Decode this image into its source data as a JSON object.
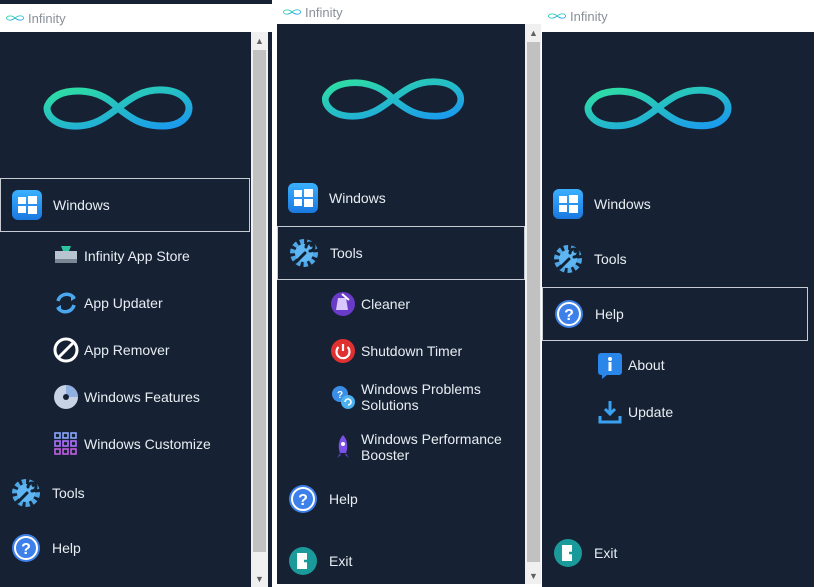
{
  "app": {
    "title": "Infinity"
  },
  "colors": {
    "bg": "#162233",
    "accent_start": "#2fd8a0",
    "accent_end": "#1aa0f0"
  },
  "window1": {
    "menu": [
      {
        "label": "Windows",
        "icon": "windows-icon",
        "selected": true
      },
      {
        "label": "Tools",
        "icon": "tools-icon",
        "selected": false
      },
      {
        "label": "Help",
        "icon": "help-icon",
        "selected": false
      }
    ],
    "submenu": [
      {
        "label": "Infinity App Store",
        "icon": "app-store-icon"
      },
      {
        "label": "App Updater",
        "icon": "updater-icon"
      },
      {
        "label": "App Remover",
        "icon": "remover-icon"
      },
      {
        "label": "Windows Features",
        "icon": "disc-icon"
      },
      {
        "label": "Windows Customize",
        "icon": "customize-icon"
      }
    ]
  },
  "window2": {
    "menu": [
      {
        "label": "Windows",
        "icon": "windows-icon",
        "selected": false
      },
      {
        "label": "Tools",
        "icon": "tools-icon",
        "selected": true
      },
      {
        "label": "Help",
        "icon": "help-icon",
        "selected": false
      },
      {
        "label": "Exit",
        "icon": "exit-icon",
        "selected": false
      }
    ],
    "submenu": [
      {
        "label": "Cleaner",
        "icon": "cleaner-icon"
      },
      {
        "label": "Shutdown Timer",
        "icon": "power-icon"
      },
      {
        "line1": "Windows Problems",
        "line2": "Solutions",
        "icon": "problems-icon"
      },
      {
        "line1": "Windows Performance",
        "line2": "Booster",
        "icon": "rocket-icon"
      }
    ]
  },
  "window3": {
    "menu": [
      {
        "label": "Windows",
        "icon": "windows-icon",
        "selected": false
      },
      {
        "label": "Tools",
        "icon": "tools-icon",
        "selected": false
      },
      {
        "label": "Help",
        "icon": "help-icon",
        "selected": true
      },
      {
        "label": "Exit",
        "icon": "exit-icon",
        "selected": false
      }
    ],
    "submenu": [
      {
        "label": "About",
        "icon": "info-icon"
      },
      {
        "label": "Update",
        "icon": "download-icon"
      }
    ]
  }
}
